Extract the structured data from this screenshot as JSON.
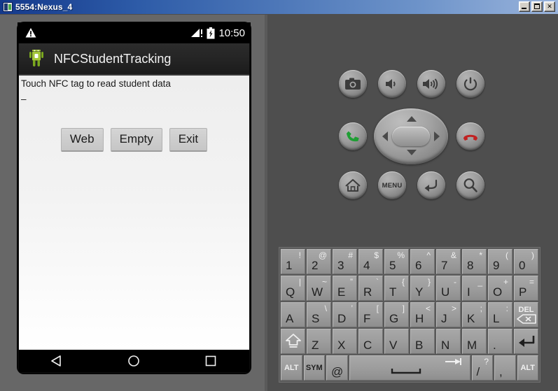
{
  "window": {
    "title": "5554:Nexus_4",
    "app_icon": "android-emulator-icon",
    "buttons": {
      "minimize": "minimize-button",
      "maximize": "maximize-button",
      "close_label": "✕"
    }
  },
  "colors": {
    "titlebar_start": "#14398c",
    "titlebar_end": "#9ab4dc",
    "left_panel_bg": "#676767",
    "right_panel_bg": "#4e4e4e",
    "keyboard_bg": "#5a5a5a",
    "key_face": "#9c9c9c",
    "android_green": "#a4c639",
    "call_green": "#1f9e34",
    "endcall_red": "#c12121",
    "statusbar_bg": "#000000",
    "actionbar_bg": "#232323",
    "content_bg": "#f3f3f3"
  },
  "phone": {
    "statusbar": {
      "warning_icon": "warning-triangle-icon",
      "signal_icon": "signal-bars-icon",
      "signal_alert": "!",
      "battery_icon": "battery-charging-icon",
      "time": "10:50"
    },
    "actionbar": {
      "app_icon": "android-robot-icon",
      "title": "NFCStudentTracking"
    },
    "content": {
      "message": "Touch NFC tag to read student data",
      "secondary": "–",
      "buttons": [
        {
          "label": "Web",
          "name": "web-button"
        },
        {
          "label": "Empty",
          "name": "empty-button"
        },
        {
          "label": "Exit",
          "name": "exit-button"
        }
      ]
    },
    "navbar": {
      "back": "back-triangle-icon",
      "home": "home-circle-icon",
      "recents": "recents-square-icon"
    }
  },
  "emulator_controls": {
    "row1": [
      {
        "name": "camera-button",
        "icon": "camera-icon"
      },
      {
        "name": "volume-down-button",
        "icon": "volume-down-icon"
      },
      {
        "name": "volume-up-button",
        "icon": "volume-up-icon"
      },
      {
        "name": "power-button",
        "icon": "power-icon"
      }
    ],
    "row2": [
      {
        "name": "call-button",
        "icon": "phone-call-icon"
      },
      {
        "name": "dpad",
        "icon": "dpad-icon"
      },
      {
        "name": "end-call-button",
        "icon": "phone-hangup-icon"
      }
    ],
    "row3": [
      {
        "name": "home-button",
        "icon": "home-icon",
        "label": ""
      },
      {
        "name": "menu-button",
        "icon": "menu-text-icon",
        "label": "MENU"
      },
      {
        "name": "back-button",
        "icon": "back-arrow-icon",
        "label": ""
      },
      {
        "name": "search-button",
        "icon": "search-icon",
        "label": ""
      }
    ]
  },
  "keyboard": {
    "rows": [
      [
        {
          "main": "1",
          "alt": "!"
        },
        {
          "main": "2",
          "alt": "@"
        },
        {
          "main": "3",
          "alt": "#"
        },
        {
          "main": "4",
          "alt": "$"
        },
        {
          "main": "5",
          "alt": "%"
        },
        {
          "main": "6",
          "alt": "^"
        },
        {
          "main": "7",
          "alt": "&"
        },
        {
          "main": "8",
          "alt": "*"
        },
        {
          "main": "9",
          "alt": "("
        },
        {
          "main": "0",
          "alt": ")"
        }
      ],
      [
        {
          "main": "Q",
          "alt": "|"
        },
        {
          "main": "W",
          "alt": "~"
        },
        {
          "main": "E",
          "alt": "”"
        },
        {
          "main": "R",
          "alt": "`"
        },
        {
          "main": "T",
          "alt": "{"
        },
        {
          "main": "Y",
          "alt": "}"
        },
        {
          "main": "U",
          "alt": "-"
        },
        {
          "main": "I",
          "alt": "_"
        },
        {
          "main": "O",
          "alt": "+"
        },
        {
          "main": "P",
          "alt": "="
        }
      ],
      [
        {
          "main": "A",
          "alt": ""
        },
        {
          "main": "S",
          "alt": "\\"
        },
        {
          "main": "D",
          "alt": "’"
        },
        {
          "main": "F",
          "alt": "["
        },
        {
          "main": "G",
          "alt": "]"
        },
        {
          "main": "H",
          "alt": "<"
        },
        {
          "main": "J",
          "alt": ">"
        },
        {
          "main": "K",
          "alt": ";"
        },
        {
          "main": "L",
          "alt": ":"
        },
        {
          "main": "DEL",
          "alt": "",
          "special": "delete-key"
        }
      ],
      [
        {
          "main": "",
          "alt": "",
          "special": "shift-key"
        },
        {
          "main": "Z",
          "alt": ""
        },
        {
          "main": "X",
          "alt": ""
        },
        {
          "main": "C",
          "alt": ""
        },
        {
          "main": "V",
          "alt": ""
        },
        {
          "main": "B",
          "alt": ""
        },
        {
          "main": "N",
          "alt": ""
        },
        {
          "main": "M",
          "alt": ""
        },
        {
          "main": ".",
          "alt": ""
        },
        {
          "main": "",
          "alt": "",
          "special": "enter-key"
        }
      ],
      [
        {
          "main": "ALT",
          "alt": "",
          "special": "alt-left-key"
        },
        {
          "main": "SYM",
          "alt": "",
          "special": "sym-key"
        },
        {
          "main": "@",
          "alt": ""
        },
        {
          "main": "",
          "alt": "",
          "special": "space-key"
        },
        {
          "main": "/",
          "alt": "?"
        },
        {
          "main": ",",
          "alt": ""
        },
        {
          "main": "ALT",
          "alt": "",
          "special": "alt-right-key"
        }
      ]
    ]
  }
}
